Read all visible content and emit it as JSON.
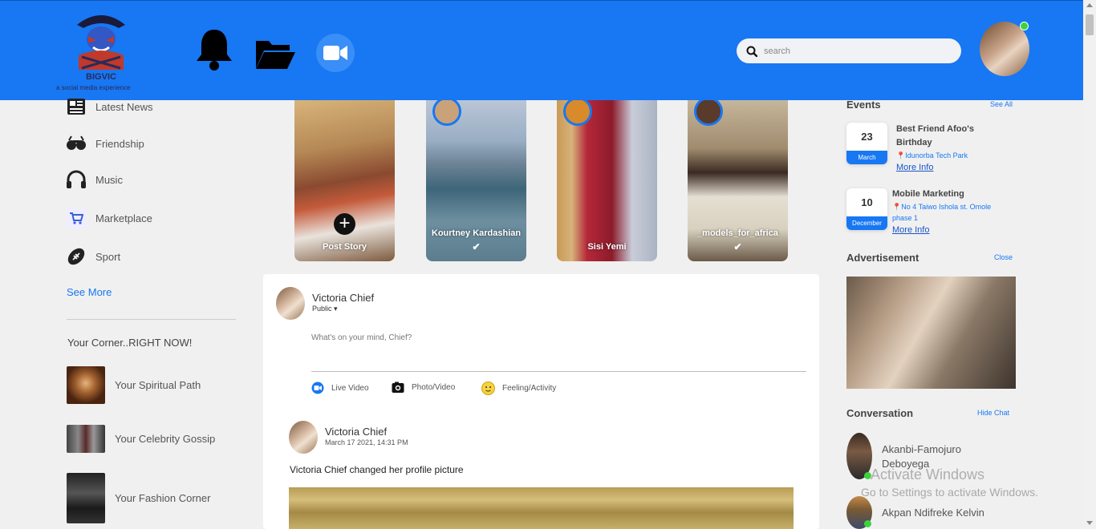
{
  "brand": {
    "name": "BIGVIC",
    "tagline": "a social media experience",
    "accent": "#1877f2"
  },
  "header": {
    "icons": [
      "bell-icon",
      "folder-open-icon",
      "video-camera-icon"
    ],
    "search_placeholder": "search"
  },
  "sidebar": {
    "items": [
      {
        "label": "Latest News",
        "icon": "newspaper-icon"
      },
      {
        "label": "Friendship",
        "icon": "glasses-icon"
      },
      {
        "label": "Music",
        "icon": "headphones-icon"
      },
      {
        "label": "Marketplace",
        "icon": "shopping-cart-icon"
      },
      {
        "label": "Sport",
        "icon": "football-icon"
      }
    ],
    "see_more": "See More",
    "corner_title": "Your Corner..RIGHT NOW!",
    "corner_items": [
      {
        "label": "Your Spiritual Path"
      },
      {
        "label": "Your Celebrity Gossip"
      },
      {
        "label": "Your Fashion Corner"
      }
    ]
  },
  "stories": [
    {
      "label": "Post Story",
      "has_plus": true
    },
    {
      "label": "Kourtney Kardashian",
      "check": "✔"
    },
    {
      "label": "Sisi Yemi"
    },
    {
      "label": "_models_for_africa",
      "check": "✔"
    }
  ],
  "composer": {
    "name": "Victoria Chief",
    "privacy": "Public ▾",
    "placeholder": "What's on your mind, Chief?",
    "actions": [
      {
        "label": "Live Video",
        "icon": "live-video-icon"
      },
      {
        "label": "Photo/Video",
        "icon": "camera-icon"
      },
      {
        "label": "Feeling/Activity",
        "icon": "smiley-icon"
      }
    ]
  },
  "post": {
    "author": "Victoria Chief",
    "date": "March 17 2021, 14:31 PM",
    "text": "Victoria Chief changed her profile picture"
  },
  "events": {
    "title": "Events",
    "see_all": "See All",
    "items": [
      {
        "day": "23",
        "month": "March",
        "title": "Best Friend Afoo's Birthday",
        "location": "Idunorba Tech Park",
        "more": "More Info"
      },
      {
        "day": "10",
        "month": "December",
        "title": "Mobile Marketing",
        "location": "No 4 Taiwo Ishola st. Omole phase 1",
        "more": "More Info"
      }
    ]
  },
  "advertisement": {
    "title": "Advertisement",
    "close": "Close"
  },
  "conversation": {
    "title": "Conversation",
    "hide": "Hide Chat",
    "items": [
      {
        "name": "Akanbi-Famojuro Deboyega",
        "online": true
      },
      {
        "name": "Akpan Ndifreke Kelvin",
        "online": true
      }
    ]
  },
  "watermark": {
    "line1": "Activate Windows",
    "line2": "Go to Settings to activate Windows."
  }
}
